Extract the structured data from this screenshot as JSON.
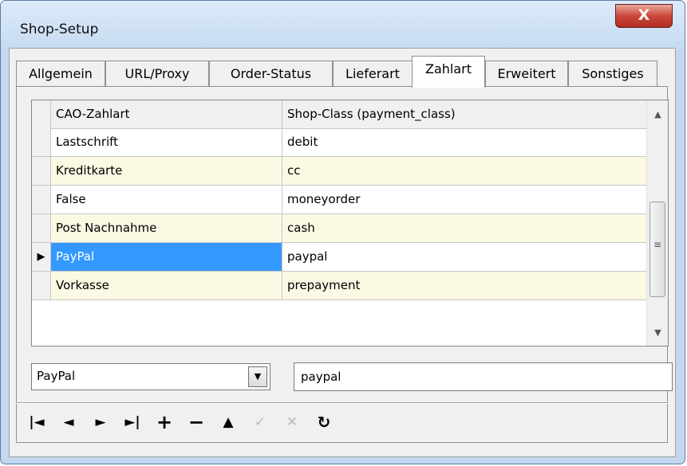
{
  "window": {
    "title": "Shop-Setup",
    "close_label": "X"
  },
  "tabs": [
    {
      "label": "Allgemein"
    },
    {
      "label": "URL/Proxy"
    },
    {
      "label": "Order-Status"
    },
    {
      "label": "Lieferart"
    },
    {
      "label": "Zahlart",
      "active": true
    },
    {
      "label": "Erweitert"
    },
    {
      "label": "Sonstiges"
    }
  ],
  "grid": {
    "columns": [
      "CAO-Zahlart",
      "Shop-Class (payment_class)"
    ],
    "rows": [
      {
        "zahlart": "Lastschrift",
        "shop_class": "debit"
      },
      {
        "zahlart": "Kreditkarte",
        "shop_class": "cc"
      },
      {
        "zahlart": "False",
        "shop_class": "moneyorder"
      },
      {
        "zahlart": "Post Nachnahme",
        "shop_class": "cash"
      },
      {
        "zahlart": "PayPal",
        "shop_class": "paypal",
        "selected": true
      },
      {
        "zahlart": "Vorkasse",
        "shop_class": "prepayment"
      }
    ]
  },
  "editor": {
    "zahlart_value": "PayPal",
    "shop_class_value": "paypal"
  },
  "navigator": [
    {
      "name": "first-record-icon",
      "glyph": "|◄"
    },
    {
      "name": "prior-record-icon",
      "glyph": "◄"
    },
    {
      "name": "next-record-icon",
      "glyph": "►"
    },
    {
      "name": "last-record-icon",
      "glyph": "►|"
    },
    {
      "name": "insert-record-icon",
      "glyph": "+"
    },
    {
      "name": "delete-record-icon",
      "glyph": "−"
    },
    {
      "name": "edit-record-icon",
      "glyph": "▲"
    },
    {
      "name": "post-record-icon",
      "glyph": "✓",
      "disabled": true
    },
    {
      "name": "cancel-record-icon",
      "glyph": "✕",
      "disabled": true
    },
    {
      "name": "refresh-icon",
      "glyph": "↻"
    }
  ],
  "colors": {
    "selected": "#3399ff",
    "alt_row": "#fbf8e3"
  }
}
